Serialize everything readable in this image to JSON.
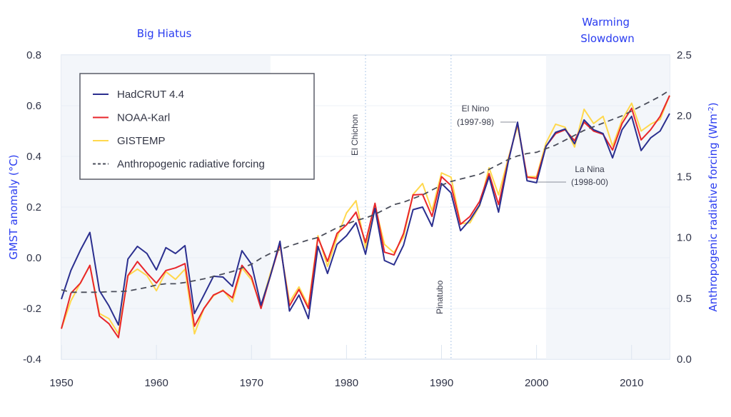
{
  "chart_data": {
    "type": "line",
    "title": "",
    "xlabel": "",
    "ylabel": "GMST anomaly (°C)",
    "y2label": "Anthropogenic radiative forcing (Wm⁻²)",
    "xlim": [
      1950,
      2014
    ],
    "ylim": [
      -0.4,
      0.8
    ],
    "y2lim": [
      0.0,
      2.5
    ],
    "xticks": [
      1950,
      1960,
      1970,
      1980,
      1990,
      2000,
      2010
    ],
    "xtick_labels": [
      "1950",
      "1960",
      "1970",
      "1980",
      "1990",
      "2000",
      "2010"
    ],
    "yticks": [
      0.8,
      0.6,
      0.4,
      0.2,
      0.0,
      -0.2,
      -0.4
    ],
    "ytick_labels": [
      "0.8",
      "0.6",
      "0.4",
      "0.2",
      "0.0",
      "-0.2",
      "-0.4"
    ],
    "y2ticks": [
      2.5,
      2.0,
      1.5,
      1.0,
      0.5,
      0.0
    ],
    "y2tick_labels": [
      "2.5",
      "2.0",
      "1.5",
      "1.0",
      "0.5",
      "0.0"
    ],
    "grid": "horizontal",
    "legend_position": "top-left",
    "shaded_regions": [
      {
        "label": "Big Hiatus",
        "x_start": 1950,
        "x_end": 1972
      },
      {
        "label": "Warming Slowdown",
        "x_start": 2001,
        "x_end": 2014
      }
    ],
    "vertical_markers": [
      {
        "label": "El Chichon",
        "x": 1982
      },
      {
        "label": "Pinatubo",
        "x": 1991
      }
    ],
    "annotations": [
      {
        "label_line1": "El Nino",
        "label_line2": "(1997-98)",
        "x": 1998
      },
      {
        "label_line1": "La Nina",
        "label_line2": "(1998-00)",
        "x": 2000
      }
    ],
    "x": [
      1950,
      1951,
      1952,
      1953,
      1954,
      1955,
      1956,
      1957,
      1958,
      1959,
      1960,
      1961,
      1962,
      1963,
      1964,
      1965,
      1966,
      1967,
      1968,
      1969,
      1970,
      1971,
      1972,
      1973,
      1974,
      1975,
      1976,
      1977,
      1978,
      1979,
      1980,
      1981,
      1982,
      1983,
      1984,
      1985,
      1986,
      1987,
      1988,
      1989,
      1990,
      1991,
      1992,
      1993,
      1994,
      1995,
      1996,
      1997,
      1998,
      1999,
      2000,
      2001,
      2002,
      2003,
      2004,
      2005,
      2006,
      2007,
      2008,
      2009,
      2010,
      2011,
      2012,
      2013,
      2014
    ],
    "series": [
      {
        "name": "HadCRUT 4.4",
        "axis": "left",
        "color": "#2b2f8f",
        "style": "solid",
        "values": [
          -0.163,
          -0.05,
          0.03,
          0.1,
          -0.13,
          -0.19,
          -0.265,
          -0.005,
          0.045,
          0.017,
          -0.048,
          0.04,
          0.017,
          0.048,
          -0.22,
          -0.147,
          -0.073,
          -0.076,
          -0.113,
          0.028,
          -0.025,
          -0.187,
          -0.07,
          0.065,
          -0.21,
          -0.147,
          -0.24,
          0.045,
          -0.062,
          0.053,
          0.087,
          0.138,
          0.014,
          0.195,
          -0.011,
          -0.028,
          0.05,
          0.19,
          0.2,
          0.124,
          0.293,
          0.256,
          0.107,
          0.15,
          0.208,
          0.32,
          0.18,
          0.375,
          0.535,
          0.304,
          0.296,
          0.44,
          0.495,
          0.508,
          0.45,
          0.544,
          0.505,
          0.49,
          0.394,
          0.505,
          0.558,
          0.423,
          0.473,
          0.5,
          0.569
        ]
      },
      {
        "name": "NOAA-Karl",
        "axis": "left",
        "color": "#e8262b",
        "style": "solid",
        "values": [
          -0.28,
          -0.14,
          -0.1,
          -0.03,
          -0.23,
          -0.26,
          -0.315,
          -0.07,
          -0.015,
          -0.06,
          -0.1,
          -0.05,
          -0.04,
          -0.023,
          -0.27,
          -0.2,
          -0.147,
          -0.13,
          -0.158,
          -0.03,
          -0.076,
          -0.2,
          -0.07,
          0.055,
          -0.19,
          -0.125,
          -0.2,
          0.08,
          -0.014,
          0.096,
          0.13,
          0.18,
          0.06,
          0.215,
          0.022,
          0.011,
          0.096,
          0.248,
          0.25,
          0.163,
          0.32,
          0.285,
          0.132,
          0.163,
          0.222,
          0.332,
          0.21,
          0.38,
          0.53,
          0.318,
          0.313,
          0.44,
          0.49,
          0.505,
          0.462,
          0.535,
          0.5,
          0.487,
          0.425,
          0.53,
          0.59,
          0.465,
          0.505,
          0.558,
          0.64
        ]
      },
      {
        "name": "GISTEMP",
        "axis": "left",
        "color": "#ffd84d",
        "style": "solid",
        "values": [
          -0.28,
          -0.17,
          -0.1,
          -0.03,
          -0.22,
          -0.24,
          -0.3,
          -0.07,
          -0.045,
          -0.07,
          -0.13,
          -0.055,
          -0.085,
          -0.045,
          -0.3,
          -0.2,
          -0.15,
          -0.127,
          -0.174,
          -0.04,
          -0.087,
          -0.19,
          -0.06,
          0.05,
          -0.175,
          -0.115,
          -0.19,
          0.087,
          -0.034,
          0.08,
          0.177,
          0.225,
          0.04,
          0.205,
          0.053,
          0.02,
          0.082,
          0.25,
          0.293,
          0.186,
          0.335,
          0.318,
          0.135,
          0.138,
          0.205,
          0.355,
          0.248,
          0.39,
          0.52,
          0.32,
          0.32,
          0.453,
          0.527,
          0.515,
          0.437,
          0.586,
          0.53,
          0.558,
          0.44,
          0.544,
          0.61,
          0.5,
          0.527,
          0.546,
          0.64
        ]
      },
      {
        "name": "Anthropogenic radiative forcing",
        "axis": "right",
        "color": "#4a4d5a",
        "style": "dashed",
        "values": [
          0.57,
          0.55,
          0.55,
          0.55,
          0.55,
          0.555,
          0.555,
          0.56,
          0.575,
          0.59,
          0.61,
          0.62,
          0.62,
          0.63,
          0.645,
          0.66,
          0.68,
          0.7,
          0.72,
          0.75,
          0.78,
          0.83,
          0.87,
          0.9,
          0.93,
          0.955,
          0.98,
          1.0,
          1.04,
          1.08,
          1.11,
          1.14,
          1.16,
          1.19,
          1.23,
          1.27,
          1.29,
          1.32,
          1.35,
          1.39,
          1.43,
          1.46,
          1.48,
          1.5,
          1.52,
          1.56,
          1.6,
          1.64,
          1.67,
          1.69,
          1.7,
          1.73,
          1.76,
          1.8,
          1.84,
          1.88,
          1.91,
          1.94,
          1.97,
          2.0,
          2.04,
          2.08,
          2.12,
          2.16,
          2.21
        ]
      }
    ]
  },
  "colors": {
    "shade": "#f3f6fa",
    "grid": "#dde6f0",
    "axis_title": "#2a3cf0",
    "marker_line": "#a9c4e6"
  }
}
